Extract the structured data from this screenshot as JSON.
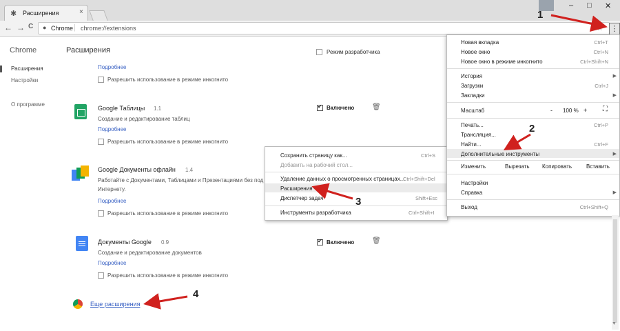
{
  "tab": {
    "title": "Расширения"
  },
  "window": {
    "minimize": "–",
    "maximize": "□",
    "close": "✕",
    "tab_close": "×"
  },
  "toolbar": {
    "back": "←",
    "forward": "→",
    "reload": "C",
    "origin": "Chrome",
    "separator": "|",
    "url": "chrome://extensions",
    "star": "☆",
    "kebab": "⋮"
  },
  "sidebar": {
    "title": "Chrome",
    "items": [
      "Расширения",
      "Настройки",
      "О программе"
    ]
  },
  "page": {
    "title": "Расширения",
    "dev_mode_label": "Режим разработчика",
    "top_partial": {
      "details": "Подробнее",
      "incognito": "Разрешить использование в режиме инкогнито"
    },
    "extensions": [
      {
        "name": "Google Таблицы",
        "version": "1.1",
        "desc": "Создание и редактирование таблиц",
        "details": "Подробнее",
        "incognito": "Разрешить использование в режиме инкогнито",
        "enabled_label": "Включено"
      },
      {
        "name": "Google Документы офлайн",
        "version": "1.4",
        "desc": "Работайте с Документами, Таблицами и Презентациями без под",
        "desc2": "Интернету.",
        "details": "Подробнее",
        "incognito": "Разрешить использование в режиме инкогнито"
      },
      {
        "name": "Документы Google",
        "version": "0.9",
        "desc": "Создание и редактирование документов",
        "details": "Подробнее",
        "incognito": "Разрешить использование в режиме инкогнито",
        "enabled_label": "Включено"
      }
    ],
    "more_extensions": "Еще расширения"
  },
  "submenu": {
    "items": [
      {
        "label": "Сохранить страницу как...",
        "shortcut": "Ctrl+S"
      },
      {
        "label": "Добавить на рабочий стол...",
        "shortcut": ""
      },
      {
        "label": "Удаление данных о просмотренных страницах...",
        "shortcut": "Ctrl+Shift+Del"
      },
      {
        "label": "Расширения",
        "shortcut": ""
      },
      {
        "label": "Диспетчер задач",
        "shortcut": "Shift+Esc"
      },
      {
        "label": "Инструменты разработчика",
        "shortcut": "Ctrl+Shift+I"
      }
    ]
  },
  "menu": {
    "new_tab": "Новая вкладка",
    "new_tab_sc": "Ctrl+T",
    "new_window": "Новое окно",
    "new_window_sc": "Ctrl+N",
    "incognito": "Новое окно в режиме инкогнито",
    "incognito_sc": "Ctrl+Shift+N",
    "history": "История",
    "downloads": "Загрузки",
    "downloads_sc": "Ctrl+J",
    "bookmarks": "Закладки",
    "zoom": "Масштаб",
    "zoom_minus": "-",
    "zoom_value": "100 %",
    "zoom_plus": "+",
    "print": "Печать...",
    "print_sc": "Ctrl+P",
    "cast": "Трансляция...",
    "find": "Найти...",
    "find_sc": "Ctrl+F",
    "more_tools": "Дополнительные инструменты",
    "edit": "Изменить",
    "cut": "Вырезать",
    "copy": "Копировать",
    "paste": "Вставить",
    "settings": "Настройки",
    "help": "Справка",
    "exit": "Выход",
    "exit_sc": "Ctrl+Shift+Q"
  },
  "annotations": [
    "1",
    "2",
    "3",
    "4"
  ]
}
